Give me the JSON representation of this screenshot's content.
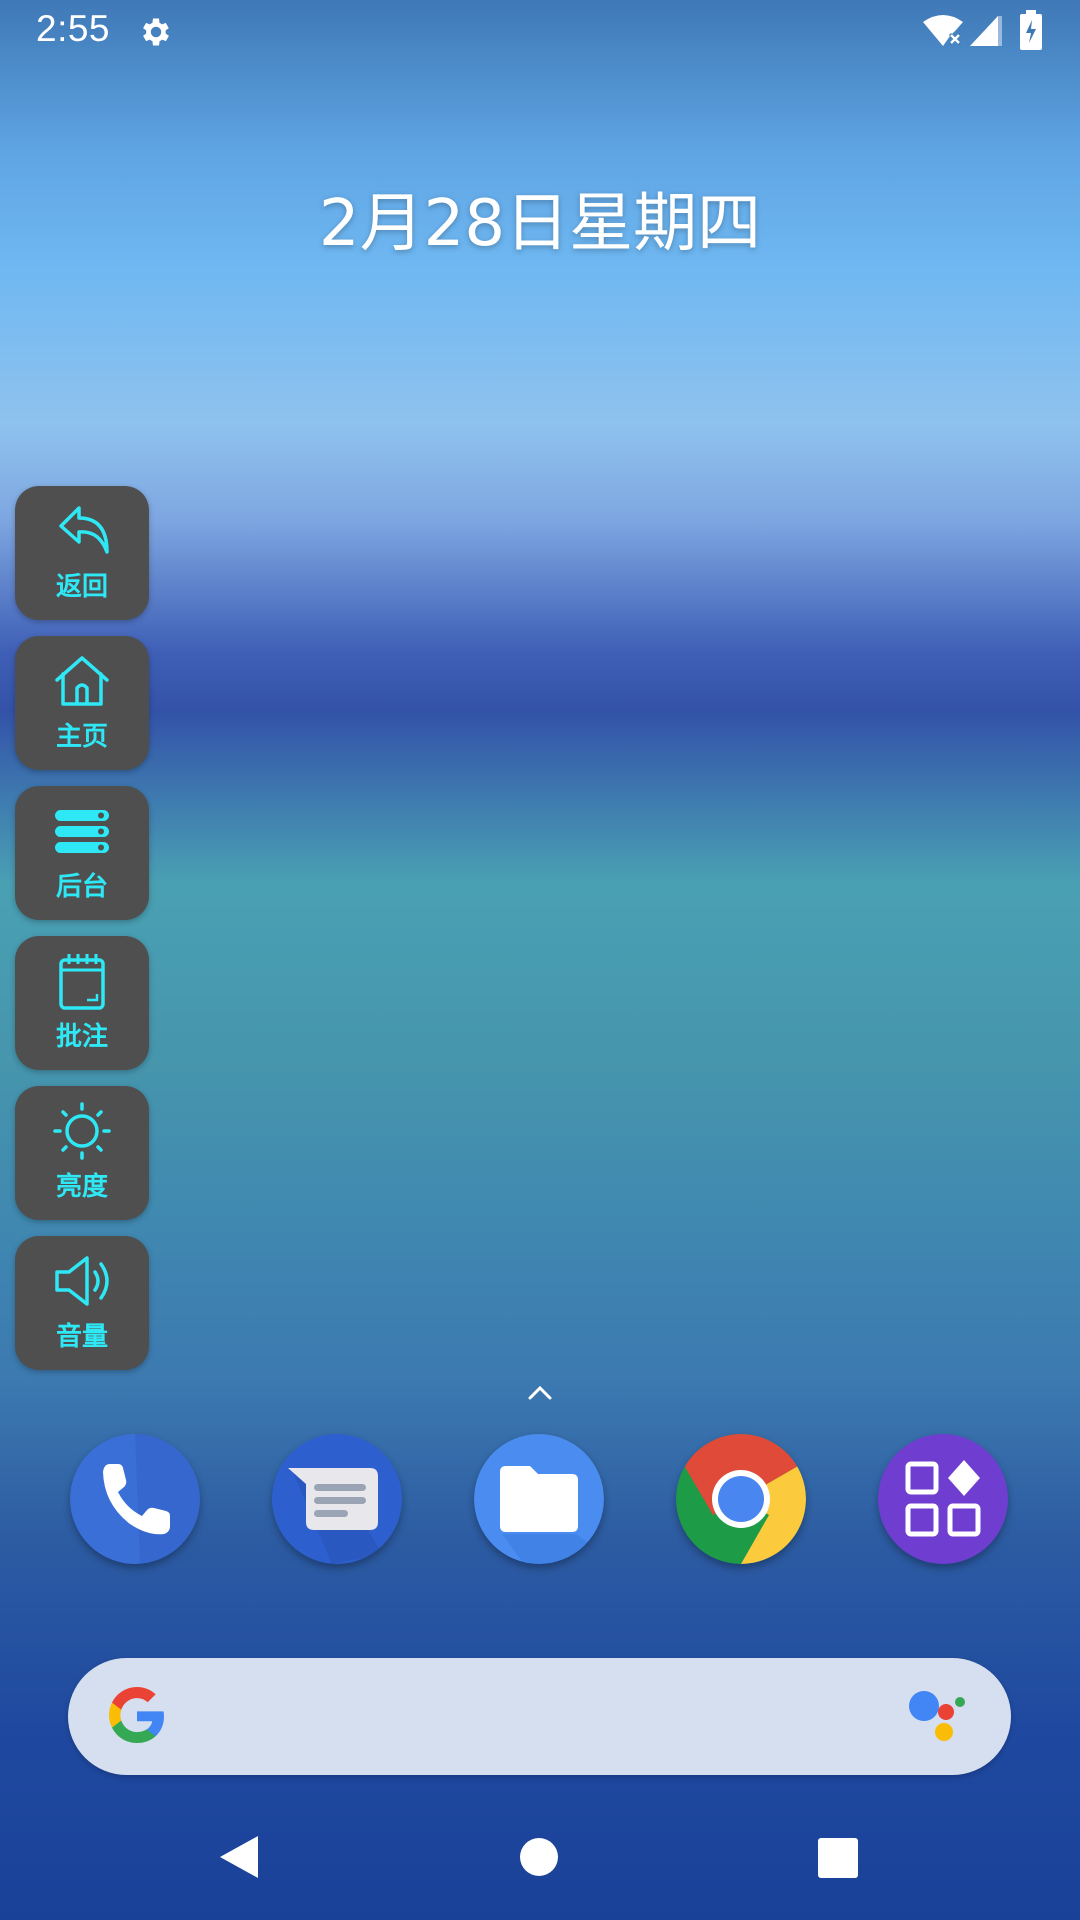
{
  "status_bar": {
    "time": "2:55",
    "icons": [
      "gear-icon",
      "wifi-off-icon",
      "signal-icon",
      "battery-charging-icon"
    ]
  },
  "date": "2月28日星期四",
  "side_panel": {
    "accent": "#2ee8f6",
    "background": "#4f4f4f",
    "items": [
      {
        "label": "返回",
        "icon": "back-arrow-icon"
      },
      {
        "label": "主页",
        "icon": "home-icon"
      },
      {
        "label": "后台",
        "icon": "recents-icon"
      },
      {
        "label": "批注",
        "icon": "notepad-icon"
      },
      {
        "label": "亮度",
        "icon": "brightness-icon"
      },
      {
        "label": "音量",
        "icon": "volume-icon"
      }
    ]
  },
  "dock": {
    "apps": [
      {
        "name": "phone",
        "icon": "phone-icon"
      },
      {
        "name": "messages",
        "icon": "messages-icon"
      },
      {
        "name": "files",
        "icon": "files-icon"
      },
      {
        "name": "chrome",
        "icon": "chrome-icon"
      },
      {
        "name": "apps",
        "icon": "app-grid-icon"
      }
    ]
  },
  "search_bar": {
    "icons": [
      "google-g-icon",
      "assistant-icon"
    ]
  },
  "navigation": {
    "icons": [
      "back-icon",
      "home-icon",
      "recents-icon"
    ]
  }
}
